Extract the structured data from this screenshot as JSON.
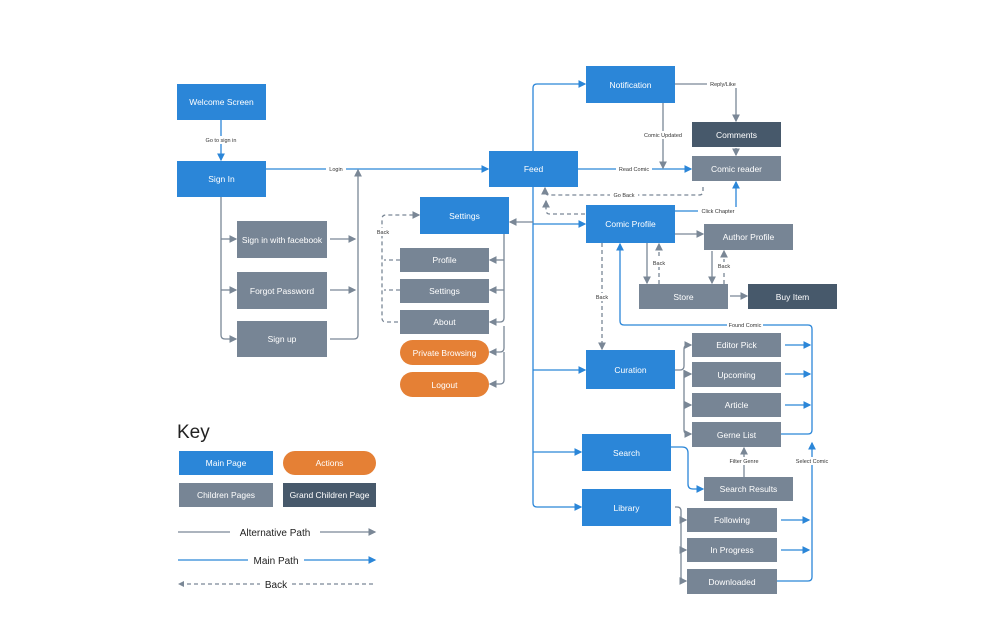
{
  "nodes": {
    "welcome": "Welcome Screen",
    "sign_in": "Sign In",
    "facebook": "Sign in with facebook",
    "forgot": "Forgot Password",
    "sign_up": "Sign up",
    "feed": "Feed",
    "settings": "Settings",
    "profile": "Profile",
    "settings_child": "Settings",
    "about": "About",
    "private": "Private Browsing",
    "logout": "Logout",
    "notification": "Notification",
    "comments": "Comments",
    "comic_reader": "Comic reader",
    "comic_profile": "Comic Profile",
    "author_profile": "Author Profile",
    "store": "Store",
    "buy_item": "Buy Item",
    "curation": "Curation",
    "editor_pick": "Editor Pick",
    "upcoming": "Upcoming",
    "article": "Article",
    "gerne_list": "Gerne List",
    "search": "Search",
    "search_results": "Search Results",
    "library": "Library",
    "following": "Following",
    "in_progress": "In Progress",
    "downloaded": "Downloaded"
  },
  "edge_labels": {
    "go_to_sign_in": "Go to sign in",
    "login": "Login",
    "reply_like": "Reply/Like",
    "comic_updated": "Comic Updated",
    "read_comic": "Read Comic",
    "go_back": "Go Back",
    "click_chapter": "Click Chapter",
    "back_settings": "Back",
    "back_store": "Back",
    "back_author": "Back",
    "back_curation": "Back",
    "found_comic": "Found Comic",
    "filter_genre": "Filter Genre",
    "select_comic": "Select Comic"
  },
  "key": {
    "title": "Key",
    "main_page": "Main Page",
    "actions": "Actions",
    "children_pages": "Children Pages",
    "grand_children_page": "Grand Children Page",
    "alternative_path": "Alternative Path",
    "main_path": "Main Path",
    "back": "Back"
  },
  "colors": {
    "main_page": "#2B86D8",
    "children_page": "#778595",
    "grand_children_page": "#47596B",
    "action": "#E58035",
    "main_path": "#2B86D8",
    "alternative_path": "#7A8796"
  }
}
